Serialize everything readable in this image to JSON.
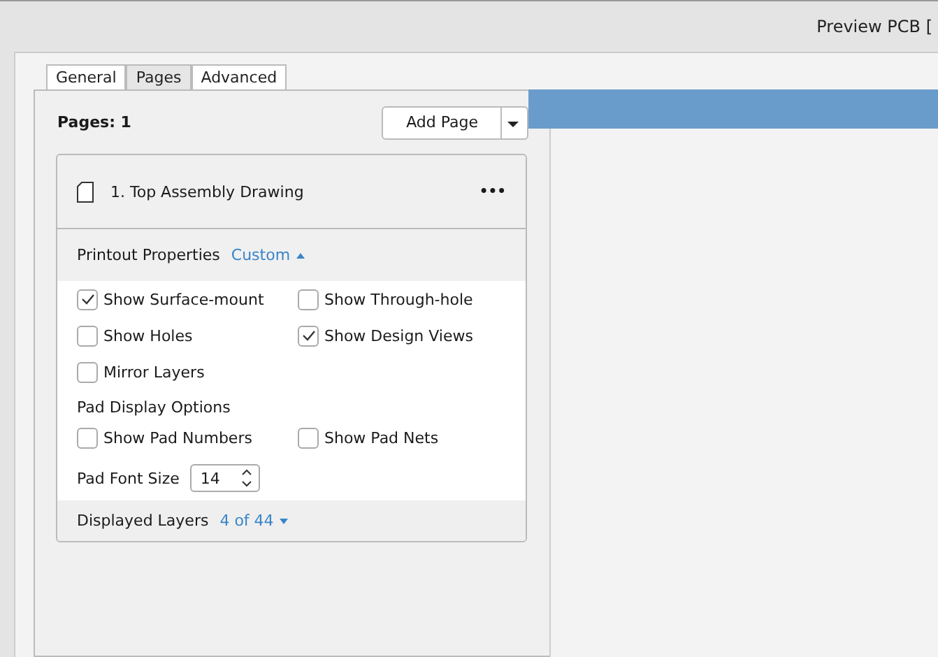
{
  "window": {
    "title": "Preview PCB ["
  },
  "tabs": [
    {
      "label": "General",
      "selected": false
    },
    {
      "label": "Pages",
      "selected": true
    },
    {
      "label": "Advanced",
      "selected": false
    }
  ],
  "pages_header": {
    "label": "Pages: 1",
    "add_button": "Add Page"
  },
  "page_card": {
    "title": "1. Top Assembly Drawing",
    "more": "•••",
    "printout": {
      "label": "Printout Properties",
      "value": "Custom",
      "expanded": true
    },
    "options": [
      {
        "label": "Show Surface-mount",
        "checked": true
      },
      {
        "label": "Show Through-hole",
        "checked": false
      },
      {
        "label": "Show Holes",
        "checked": false
      },
      {
        "label": "Show Design Views",
        "checked": true
      },
      {
        "label": "Mirror Layers",
        "checked": false
      }
    ],
    "pad_section": "Pad Display Options",
    "pad_options": [
      {
        "label": "Show Pad Numbers",
        "checked": false
      },
      {
        "label": "Show Pad Nets",
        "checked": false
      }
    ],
    "font_size": {
      "label": "Pad Font Size",
      "value": "14"
    },
    "layers": {
      "label": "Displayed Layers",
      "value": "4 of 44",
      "expanded": false
    }
  }
}
